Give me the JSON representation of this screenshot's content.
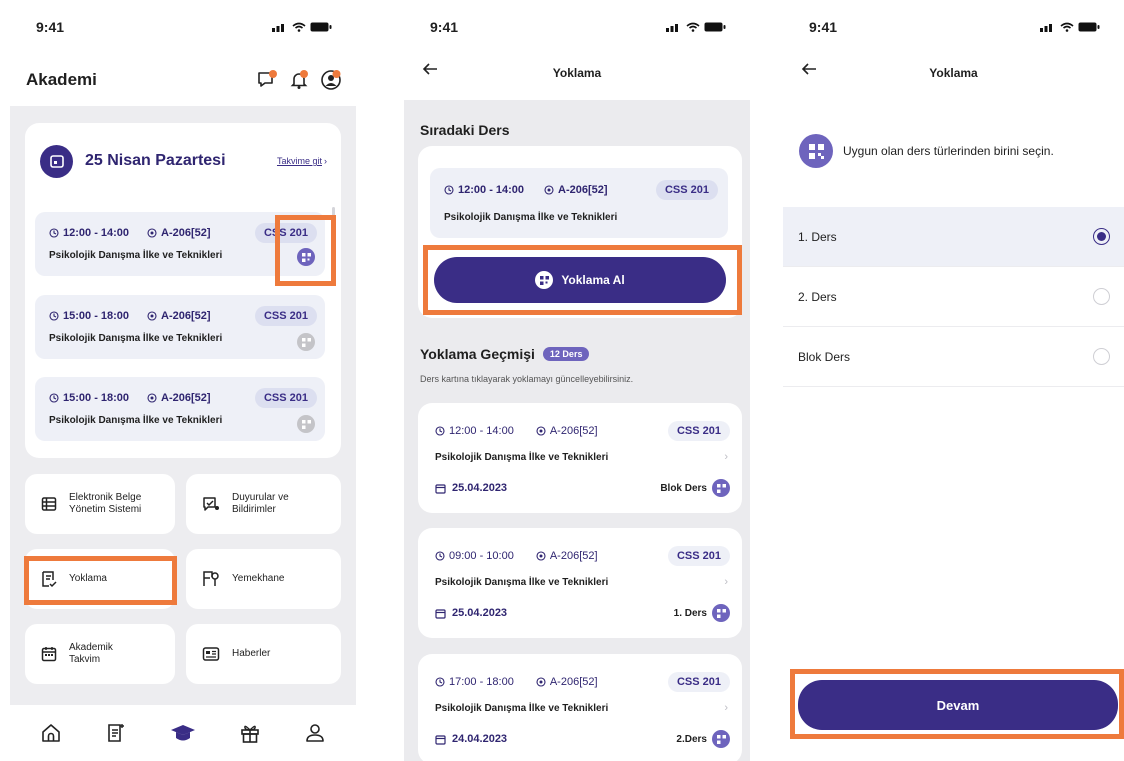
{
  "status": {
    "time": "9:41"
  },
  "colors": {
    "primary": "#3a2d86",
    "accent_light": "#6e64bd",
    "highlight": "#ee7a3c",
    "surface_tint": "#eef0f7"
  },
  "screen1": {
    "title": "Akademi",
    "header_icons": [
      "chat-icon",
      "bell-icon",
      "avatar"
    ],
    "calendar": {
      "date": "25 Nisan Pazartesi",
      "link": "Takvime git",
      "lessons": [
        {
          "time": "12:00 - 14:00",
          "room": "A-206[52]",
          "code": "CSS 201",
          "name": "Psikolojik Danışma İlke ve Teknikleri",
          "qr_active": true
        },
        {
          "time": "15:00 - 18:00",
          "room": "A-206[52]",
          "code": "CSS 201",
          "name": "Psikolojik Danışma İlke ve Teknikleri",
          "qr_active": false
        },
        {
          "time": "15:00 - 18:00",
          "room": "A-206[52]",
          "code": "CSS 201",
          "name": "Psikolojik Danışma İlke ve Teknikleri",
          "qr_active": false
        }
      ]
    },
    "tiles": [
      {
        "label": "Elektronik Belge Yönetim Sistemi",
        "icon": "document-table-icon"
      },
      {
        "label": "Duyurular ve Bildirimler",
        "icon": "announcement-icon"
      },
      {
        "label": "Yoklama",
        "icon": "attendance-icon"
      },
      {
        "label": "Yemekhane",
        "icon": "cafeteria-icon"
      },
      {
        "label": "Akademik Takvim",
        "icon": "calendar-icon"
      },
      {
        "label": "Haberler",
        "icon": "news-icon"
      }
    ],
    "tabbar": [
      "home-icon",
      "notes-icon",
      "graduation-cap-icon",
      "gift-icon",
      "profile-icon"
    ]
  },
  "screen2": {
    "title": "Yoklama",
    "next_section": "Sıradaki Ders",
    "next_lesson": {
      "time": "12:00 - 14:00",
      "room": "A-206[52]",
      "code": "CSS 201",
      "name": "Psikolojik Danışma İlke ve Teknikleri"
    },
    "take_button": "Yoklama Al",
    "history_title": "Yoklama Geçmişi",
    "history_count": "12 Ders",
    "history_sub": "Ders kartına tıklayarak yoklamayı güncelleyebilirsiniz.",
    "history": [
      {
        "time": "12:00 - 14:00",
        "room": "A-206[52]",
        "code": "CSS 201",
        "name": "Psikolojik Danışma İlke ve Teknikleri",
        "date": "25.04.2023",
        "type": "Blok Ders"
      },
      {
        "time": "09:00 - 10:00",
        "room": "A-206[52]",
        "code": "CSS 201",
        "name": "Psikolojik Danışma İlke ve Teknikleri",
        "date": "25.04.2023",
        "type": "1. Ders"
      },
      {
        "time": "17:00 - 18:00",
        "room": "A-206[52]",
        "code": "CSS 201",
        "name": "Psikolojik Danışma İlke ve Teknikleri",
        "date": "24.04.2023",
        "type": "2.Ders"
      }
    ]
  },
  "screen3": {
    "title": "Yoklama",
    "prompt": "Uygun olan ders türlerinden birini seçin.",
    "options": [
      {
        "label": "1. Ders",
        "selected": true
      },
      {
        "label": "2. Ders",
        "selected": false
      },
      {
        "label": "Blok Ders",
        "selected": false
      }
    ],
    "continue_button": "Devam"
  }
}
